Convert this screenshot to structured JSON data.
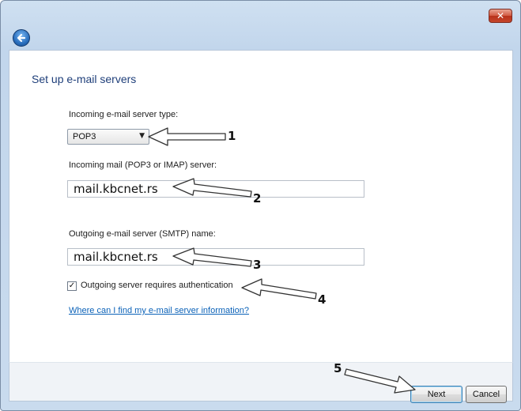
{
  "window": {
    "close_label": "✕",
    "back_icon": "back-arrow-icon"
  },
  "page": {
    "heading": "Set up e-mail servers"
  },
  "incoming_type": {
    "label": "Incoming e-mail server type:",
    "value": "POP3",
    "caret": "▼"
  },
  "incoming_server": {
    "label": "Incoming mail (POP3 or IMAP) server:",
    "value": "mail.kbcnet.rs"
  },
  "outgoing_server": {
    "label": "Outgoing e-mail server (SMTP) name:",
    "value": "mail.kbcnet.rs"
  },
  "auth": {
    "checked_mark": "✓",
    "label": "Outgoing server requires authentication",
    "checked": true
  },
  "help_link": "Where can I find my e-mail server information?",
  "buttons": {
    "next": "Next",
    "cancel": "Cancel"
  },
  "annotations": [
    "1",
    "2",
    "3",
    "4",
    "5"
  ]
}
